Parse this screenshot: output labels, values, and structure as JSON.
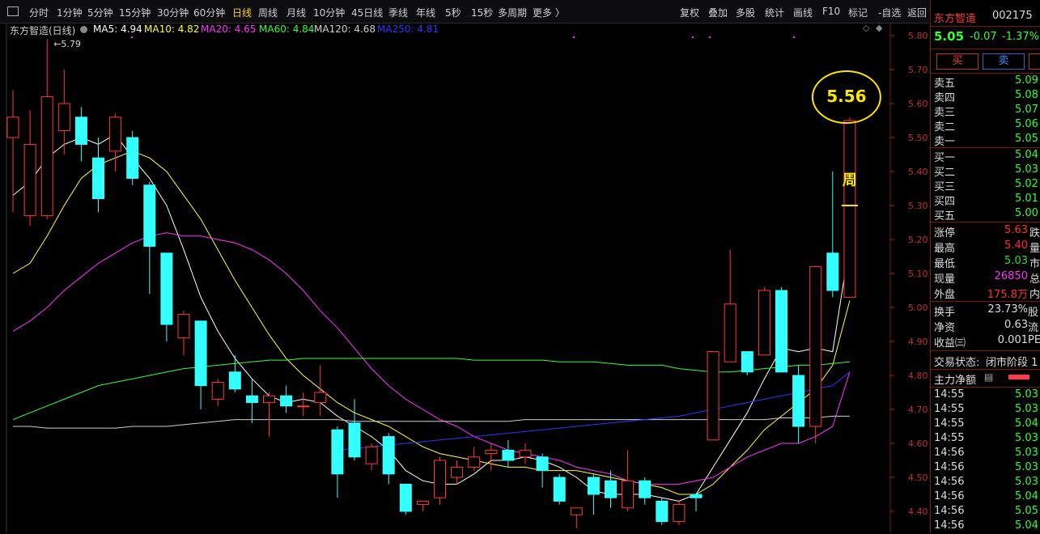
{
  "toolbar": {
    "periods": [
      "分时",
      "1分钟",
      "5分钟",
      "15分钟",
      "30分钟",
      "60分钟",
      "日线",
      "周线",
      "月线",
      "10分钟",
      "45日线",
      "季线",
      "年线",
      "5秒",
      "15秒",
      "多周期",
      "更多 〉"
    ],
    "active_period": "日线",
    "actions": [
      "复权",
      "叠加",
      "多股",
      "统计",
      "画线",
      "F10",
      "标记",
      "-自选",
      "返回"
    ]
  },
  "legend": {
    "title": "东方智造(日线)",
    "ma": [
      {
        "label": "MA5: 4.94",
        "color": "#ffffff"
      },
      {
        "label": "MA10: 4.82",
        "color": "#ffff33"
      },
      {
        "label": "MA20: 4.65",
        "color": "#ff33ff"
      },
      {
        "label": "MA60: 4.84",
        "color": "#33ff33"
      },
      {
        "label": "MA120: 4.68",
        "color": "#cfcfcf"
      },
      {
        "label": "MA250: 4.81",
        "color": "#3333ff"
      }
    ]
  },
  "chart_data": {
    "type": "candlestick",
    "y_range": [
      4.35,
      5.84
    ],
    "y_ticks": [
      "5.80",
      "5.70",
      "5.60",
      "5.50",
      "5.40",
      "5.30",
      "5.20",
      "5.10",
      "5.00",
      "4.90",
      "4.80",
      "4.70",
      "4.60",
      "4.50",
      "4.40"
    ],
    "candles": [
      {
        "o": 5.5,
        "h": 5.64,
        "l": 5.28,
        "c": 5.56
      },
      {
        "o": 5.27,
        "h": 5.58,
        "l": 5.24,
        "c": 5.48
      },
      {
        "o": 5.27,
        "h": 5.79,
        "l": 5.26,
        "c": 5.62
      },
      {
        "o": 5.52,
        "h": 5.7,
        "l": 5.45,
        "c": 5.6
      },
      {
        "o": 5.56,
        "h": 5.59,
        "l": 5.43,
        "c": 5.48
      },
      {
        "o": 5.44,
        "h": 5.5,
        "l": 5.28,
        "c": 5.32
      },
      {
        "o": 5.46,
        "h": 5.57,
        "l": 5.4,
        "c": 5.56
      },
      {
        "o": 5.5,
        "h": 5.52,
        "l": 5.36,
        "c": 5.38
      },
      {
        "o": 5.36,
        "h": 5.37,
        "l": 5.04,
        "c": 5.18
      },
      {
        "o": 5.16,
        "h": 5.16,
        "l": 4.9,
        "c": 4.95
      },
      {
        "o": 4.91,
        "h": 4.99,
        "l": 4.86,
        "c": 4.98
      },
      {
        "o": 4.96,
        "h": 4.96,
        "l": 4.7,
        "c": 4.77
      },
      {
        "o": 4.73,
        "h": 4.79,
        "l": 4.71,
        "c": 4.78
      },
      {
        "o": 4.81,
        "h": 4.86,
        "l": 4.75,
        "c": 4.76
      },
      {
        "o": 4.74,
        "h": 4.79,
        "l": 4.66,
        "c": 4.72
      },
      {
        "o": 4.72,
        "h": 4.75,
        "l": 4.62,
        "c": 4.74
      },
      {
        "o": 4.74,
        "h": 4.77,
        "l": 4.69,
        "c": 4.71
      },
      {
        "o": 4.71,
        "h": 4.75,
        "l": 4.68,
        "c": 4.71
      },
      {
        "o": 4.72,
        "h": 4.83,
        "l": 4.68,
        "c": 4.75
      },
      {
        "o": 4.64,
        "h": 4.65,
        "l": 4.44,
        "c": 4.51
      },
      {
        "o": 4.66,
        "h": 4.73,
        "l": 4.55,
        "c": 4.56
      },
      {
        "o": 4.54,
        "h": 4.6,
        "l": 4.52,
        "c": 4.59
      },
      {
        "o": 4.62,
        "h": 4.63,
        "l": 4.48,
        "c": 4.51
      },
      {
        "o": 4.48,
        "h": 4.48,
        "l": 4.39,
        "c": 4.4
      },
      {
        "o": 4.42,
        "h": 4.43,
        "l": 4.4,
        "c": 4.43
      },
      {
        "o": 4.44,
        "h": 4.56,
        "l": 4.42,
        "c": 4.55
      },
      {
        "o": 4.5,
        "h": 4.55,
        "l": 4.48,
        "c": 4.53
      },
      {
        "o": 4.53,
        "h": 4.59,
        "l": 4.52,
        "c": 4.56
      },
      {
        "o": 4.57,
        "h": 4.6,
        "l": 4.52,
        "c": 4.58
      },
      {
        "o": 4.58,
        "h": 4.61,
        "l": 4.53,
        "c": 4.55
      },
      {
        "o": 4.56,
        "h": 4.6,
        "l": 4.54,
        "c": 4.58
      },
      {
        "o": 4.56,
        "h": 4.57,
        "l": 4.47,
        "c": 4.52
      },
      {
        "o": 4.5,
        "h": 4.51,
        "l": 4.42,
        "c": 4.43
      },
      {
        "o": 4.39,
        "h": 4.41,
        "l": 4.35,
        "c": 4.41
      },
      {
        "o": 4.5,
        "h": 4.51,
        "l": 4.39,
        "c": 4.45
      },
      {
        "o": 4.49,
        "h": 4.52,
        "l": 4.41,
        "c": 4.44
      },
      {
        "o": 4.41,
        "h": 4.58,
        "l": 4.4,
        "c": 4.49
      },
      {
        "o": 4.49,
        "h": 4.5,
        "l": 4.42,
        "c": 4.44
      },
      {
        "o": 4.43,
        "h": 4.44,
        "l": 4.36,
        "c": 4.37
      },
      {
        "o": 4.37,
        "h": 4.43,
        "l": 4.36,
        "c": 4.42
      },
      {
        "o": 4.45,
        "h": 4.45,
        "l": 4.4,
        "c": 4.44
      },
      {
        "o": 4.61,
        "h": 4.87,
        "l": 4.61,
        "c": 4.87
      },
      {
        "o": 4.84,
        "h": 5.17,
        "l": 4.84,
        "c": 5.01
      },
      {
        "o": 4.87,
        "h": 4.87,
        "l": 4.8,
        "c": 4.81
      },
      {
        "o": 4.86,
        "h": 5.06,
        "l": 4.86,
        "c": 5.05
      },
      {
        "o": 5.05,
        "h": 5.06,
        "l": 4.81,
        "c": 4.81
      },
      {
        "o": 4.8,
        "h": 4.83,
        "l": 4.6,
        "c": 4.65
      },
      {
        "o": 4.65,
        "h": 5.12,
        "l": 4.6,
        "c": 5.12
      },
      {
        "o": 5.16,
        "h": 5.4,
        "l": 5.03,
        "c": 5.05
      },
      {
        "o": 5.03,
        "h": 5.56,
        "l": 5.03,
        "c": 5.55
      }
    ],
    "ma_lines": [
      {
        "name": "MA5",
        "color": "#ffffff",
        "values": [
          5.33,
          5.37,
          5.44,
          5.48,
          5.5,
          5.48,
          5.51,
          5.44,
          5.38,
          5.3,
          5.17,
          5.03,
          4.93,
          4.85,
          4.79,
          4.74,
          4.72,
          4.73,
          4.72,
          4.68,
          4.65,
          4.62,
          4.58,
          4.52,
          4.49,
          4.48,
          4.48,
          4.51,
          4.55,
          4.55,
          4.56,
          4.55,
          4.53,
          4.5,
          4.46,
          4.45,
          4.45,
          4.45,
          4.44,
          4.43,
          4.45,
          4.53,
          4.61,
          4.69,
          4.79,
          4.88,
          4.87,
          4.88,
          4.87,
          5.19
        ]
      },
      {
        "name": "MA10",
        "color": "#ffff33",
        "values": [
          5.1,
          5.13,
          5.21,
          5.3,
          5.38,
          5.42,
          5.44,
          5.46,
          5.44,
          5.4,
          5.33,
          5.26,
          5.17,
          5.08,
          5.0,
          4.92,
          4.85,
          4.8,
          4.76,
          4.72,
          4.69,
          4.67,
          4.65,
          4.62,
          4.59,
          4.57,
          4.56,
          4.55,
          4.54,
          4.53,
          4.53,
          4.52,
          4.52,
          4.52,
          4.51,
          4.5,
          4.49,
          4.48,
          4.47,
          4.45,
          4.45,
          4.48,
          4.53,
          4.58,
          4.64,
          4.68,
          4.72,
          4.76,
          4.83,
          5.02
        ]
      },
      {
        "name": "MA20",
        "color": "#ff33ff",
        "values": [
          4.93,
          4.96,
          5.0,
          5.05,
          5.09,
          5.13,
          5.16,
          5.19,
          5.21,
          5.22,
          5.21,
          5.21,
          5.2,
          5.19,
          5.17,
          5.14,
          5.1,
          5.05,
          4.99,
          4.94,
          4.88,
          4.82,
          4.77,
          4.73,
          4.7,
          4.67,
          4.65,
          4.62,
          4.6,
          4.58,
          4.57,
          4.56,
          4.55,
          4.53,
          4.52,
          4.51,
          4.49,
          4.48,
          4.48,
          4.48,
          4.49,
          4.5,
          4.53,
          4.56,
          4.58,
          4.6,
          4.6,
          4.62,
          4.65,
          4.81
        ]
      },
      {
        "name": "MA60",
        "color": "#33ff33",
        "values": [
          4.67,
          4.69,
          4.71,
          4.73,
          4.75,
          4.77,
          4.78,
          4.79,
          4.8,
          4.81,
          4.82,
          4.825,
          4.83,
          4.835,
          4.84,
          4.845,
          4.845,
          4.85,
          4.85,
          4.85,
          4.85,
          4.85,
          4.85,
          4.85,
          4.85,
          4.85,
          4.85,
          4.845,
          4.845,
          4.845,
          4.845,
          4.845,
          4.84,
          4.84,
          4.84,
          4.835,
          4.83,
          4.83,
          4.83,
          4.82,
          4.815,
          4.81,
          4.81,
          4.815,
          4.82,
          4.825,
          4.83,
          4.83,
          4.835,
          4.84
        ]
      },
      {
        "name": "MA120",
        "color": "#cfcfcf",
        "values": [
          4.65,
          4.65,
          4.645,
          4.645,
          4.645,
          4.645,
          4.645,
          4.65,
          4.65,
          4.65,
          4.655,
          4.66,
          4.665,
          4.67,
          4.67,
          4.67,
          4.67,
          4.67,
          4.67,
          4.67,
          4.665,
          4.665,
          4.665,
          4.665,
          4.665,
          4.665,
          4.665,
          4.665,
          4.665,
          4.665,
          4.67,
          4.67,
          4.67,
          4.67,
          4.67,
          4.67,
          4.67,
          4.67,
          4.67,
          4.67,
          4.67,
          4.67,
          4.67,
          4.67,
          4.67,
          4.675,
          4.675,
          4.675,
          4.68,
          4.68
        ]
      },
      {
        "name": "MA250",
        "color": "#3333ff",
        "start_index": 19,
        "values": [
          4.58,
          4.585,
          4.59,
          4.595,
          4.6,
          4.605,
          4.61,
          4.615,
          4.62,
          4.625,
          4.63,
          4.635,
          4.64,
          4.645,
          4.65,
          4.655,
          4.66,
          4.665,
          4.67,
          4.675,
          4.68,
          4.69,
          4.7,
          4.71,
          4.72,
          4.73,
          4.74,
          4.75,
          4.76,
          4.77,
          4.81
        ]
      }
    ],
    "annotations": {
      "high_label": "5.79",
      "circle_label": "5.56",
      "week_char": "周",
      "week_dash": "—"
    }
  },
  "quote": {
    "name": "东方智造",
    "code": "002175",
    "price": "5.05",
    "change": "-0.07",
    "pct": "-1.37%",
    "buy_btn": "买",
    "sell_btn": "卖",
    "asks": [
      {
        "label": "卖五",
        "price": "5.09"
      },
      {
        "label": "卖四",
        "price": "5.08"
      },
      {
        "label": "卖三",
        "price": "5.07"
      },
      {
        "label": "卖二",
        "price": "5.06"
      },
      {
        "label": "卖一",
        "price": "5.05"
      }
    ],
    "bids": [
      {
        "label": "买一",
        "price": "5.04"
      },
      {
        "label": "买二",
        "price": "5.03"
      },
      {
        "label": "买三",
        "price": "5.02"
      },
      {
        "label": "买四",
        "price": "5.01"
      },
      {
        "label": "买五",
        "price": "5.00"
      }
    ],
    "stats": [
      {
        "label": "涨停",
        "value": "5.63",
        "color": "#ff3030",
        "tail": "跌"
      },
      {
        "label": "最高",
        "value": "5.40",
        "color": "#ff3030",
        "tail": "量"
      },
      {
        "label": "最低",
        "value": "5.03",
        "color": "#33dd33",
        "tail": "市"
      },
      {
        "label": "现量",
        "value": "26850",
        "color": "#ff33ff",
        "tail": "总"
      },
      {
        "label": "外盘",
        "value": "175.8万",
        "color": "#ff3030",
        "tail": "内"
      }
    ],
    "stats2": [
      {
        "label": "换手",
        "value": "23.73%",
        "tail": "股"
      },
      {
        "label": "净资",
        "value": "0.63",
        "tail": "流"
      },
      {
        "label": "收益㈢",
        "value": "0.001",
        "tail": "PE"
      }
    ],
    "trade_status_label": "交易状态:",
    "trade_status_value": "闭市阶段 1",
    "main_flow_label": "主力净额",
    "ticks": [
      {
        "time": "14:55",
        "price": "5.03"
      },
      {
        "time": "14:55",
        "price": "5.03"
      },
      {
        "time": "14:55",
        "price": "5.04"
      },
      {
        "time": "14:55",
        "price": "5.03"
      },
      {
        "time": "14:56",
        "price": "5.03"
      },
      {
        "time": "14:56",
        "price": "5.03"
      },
      {
        "time": "14:56",
        "price": "5.03"
      },
      {
        "time": "14:56",
        "price": "5.04"
      },
      {
        "time": "14:56",
        "price": "5.05"
      },
      {
        "time": "14:56",
        "price": "5.04"
      }
    ]
  }
}
